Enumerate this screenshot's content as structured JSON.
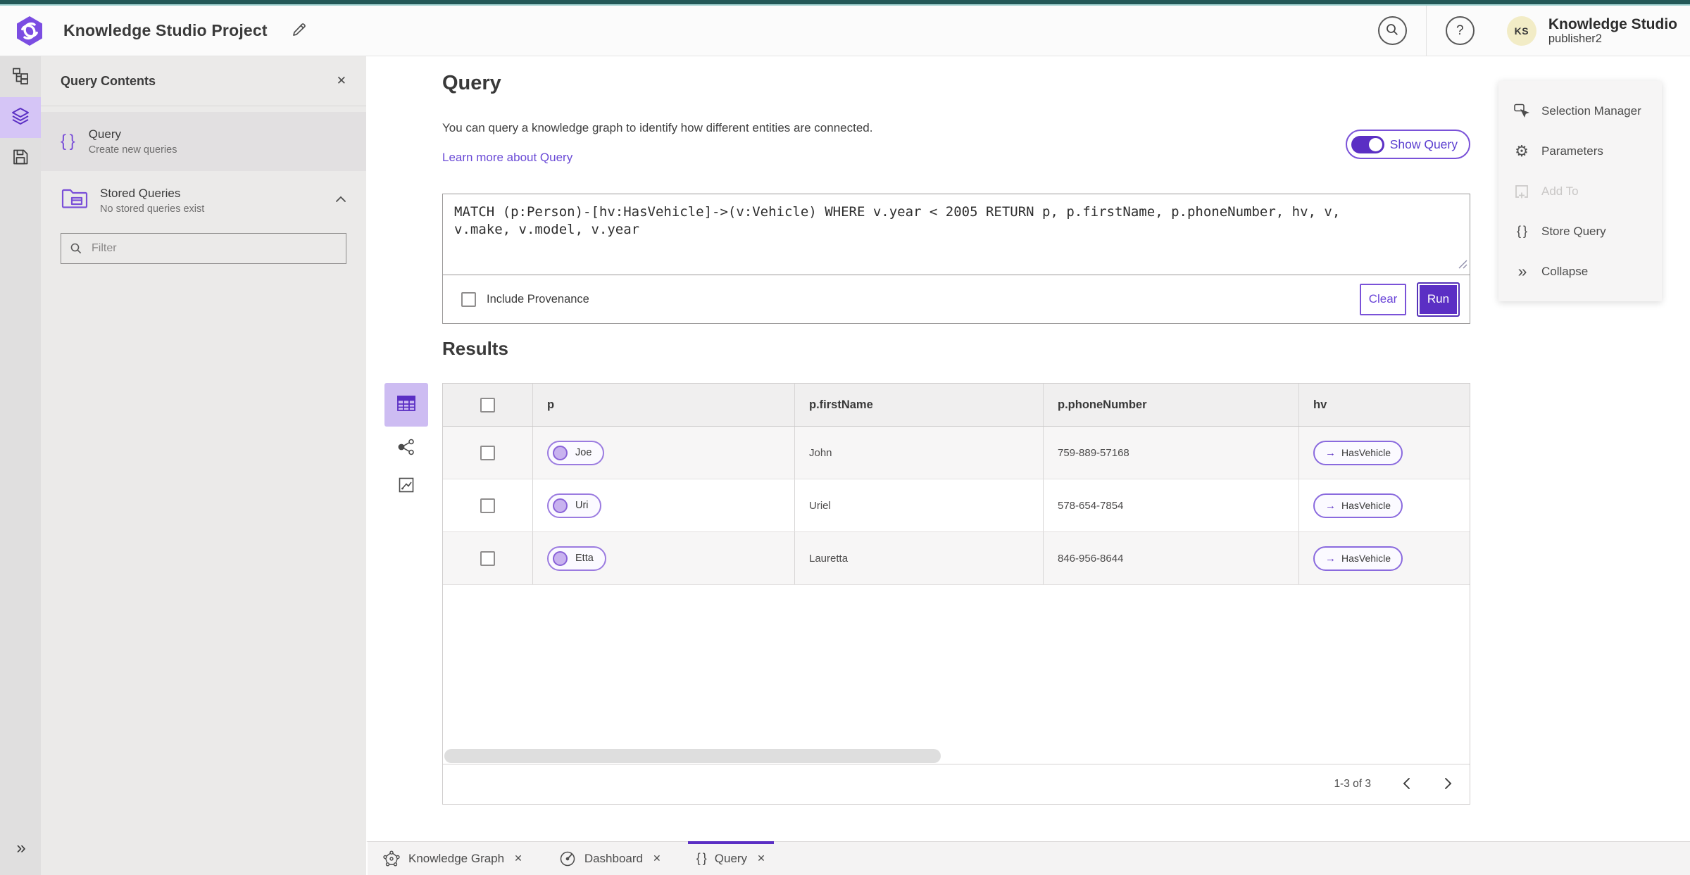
{
  "colors": {
    "accent": "#5B2FC4",
    "accent_light": "#D5C5F6",
    "teal_top": "#235857",
    "link": "#6A4AD6",
    "avatar_bg": "#F2ECC6"
  },
  "icons": {
    "help": "?",
    "close": "✕",
    "braces": "{ }",
    "arrow_right": "→",
    "collapse": "»",
    "expand": "»",
    "gear": "⚙"
  },
  "header": {
    "app_title": "Knowledge Studio Project",
    "user_name": "Knowledge Studio",
    "user_role": "publisher2",
    "avatar": "KS"
  },
  "query_contents": {
    "title": "Query Contents",
    "query_item": {
      "title": "Query",
      "subtitle": "Create new queries"
    },
    "stored_item": {
      "title": "Stored Queries",
      "subtitle": "No stored queries exist"
    },
    "filter_placeholder": "Filter"
  },
  "query_panel": {
    "heading": "Query",
    "description": "You can query a knowledge graph to identify how different entities are connected.",
    "learn_more": "Learn more about Query",
    "show_query": "Show Query",
    "query_text": "MATCH (p:Person)-[hv:HasVehicle]->(v:Vehicle) WHERE v.year < 2005 RETURN p, p.firstName, p.phoneNumber, hv, v,\nv.make, v.model, v.year",
    "include_provenance": "Include Provenance",
    "clear": "Clear",
    "run": "Run"
  },
  "results": {
    "heading": "Results",
    "columns": [
      "p",
      "p.firstName",
      "p.phoneNumber",
      "hv"
    ],
    "rows": [
      {
        "p": "Joe",
        "firstName": "John",
        "phoneNumber": "759-889-57168",
        "hv": "HasVehicle"
      },
      {
        "p": "Uri",
        "firstName": "Uriel",
        "phoneNumber": "578-654-7854",
        "hv": "HasVehicle"
      },
      {
        "p": "Etta",
        "firstName": "Lauretta",
        "phoneNumber": "846-956-8644",
        "hv": "HasVehicle"
      }
    ],
    "pagination": "1-3 of 3"
  },
  "right_panel": {
    "items": [
      {
        "label": "Selection Manager",
        "disabled": false
      },
      {
        "label": "Parameters",
        "disabled": false
      },
      {
        "label": "Add To",
        "disabled": true
      },
      {
        "label": "Store Query",
        "disabled": false
      },
      {
        "label": "Collapse",
        "disabled": false
      }
    ]
  },
  "tabs": [
    {
      "label": "Knowledge Graph",
      "active": false
    },
    {
      "label": "Dashboard",
      "active": false
    },
    {
      "label": "Query",
      "active": true
    }
  ]
}
